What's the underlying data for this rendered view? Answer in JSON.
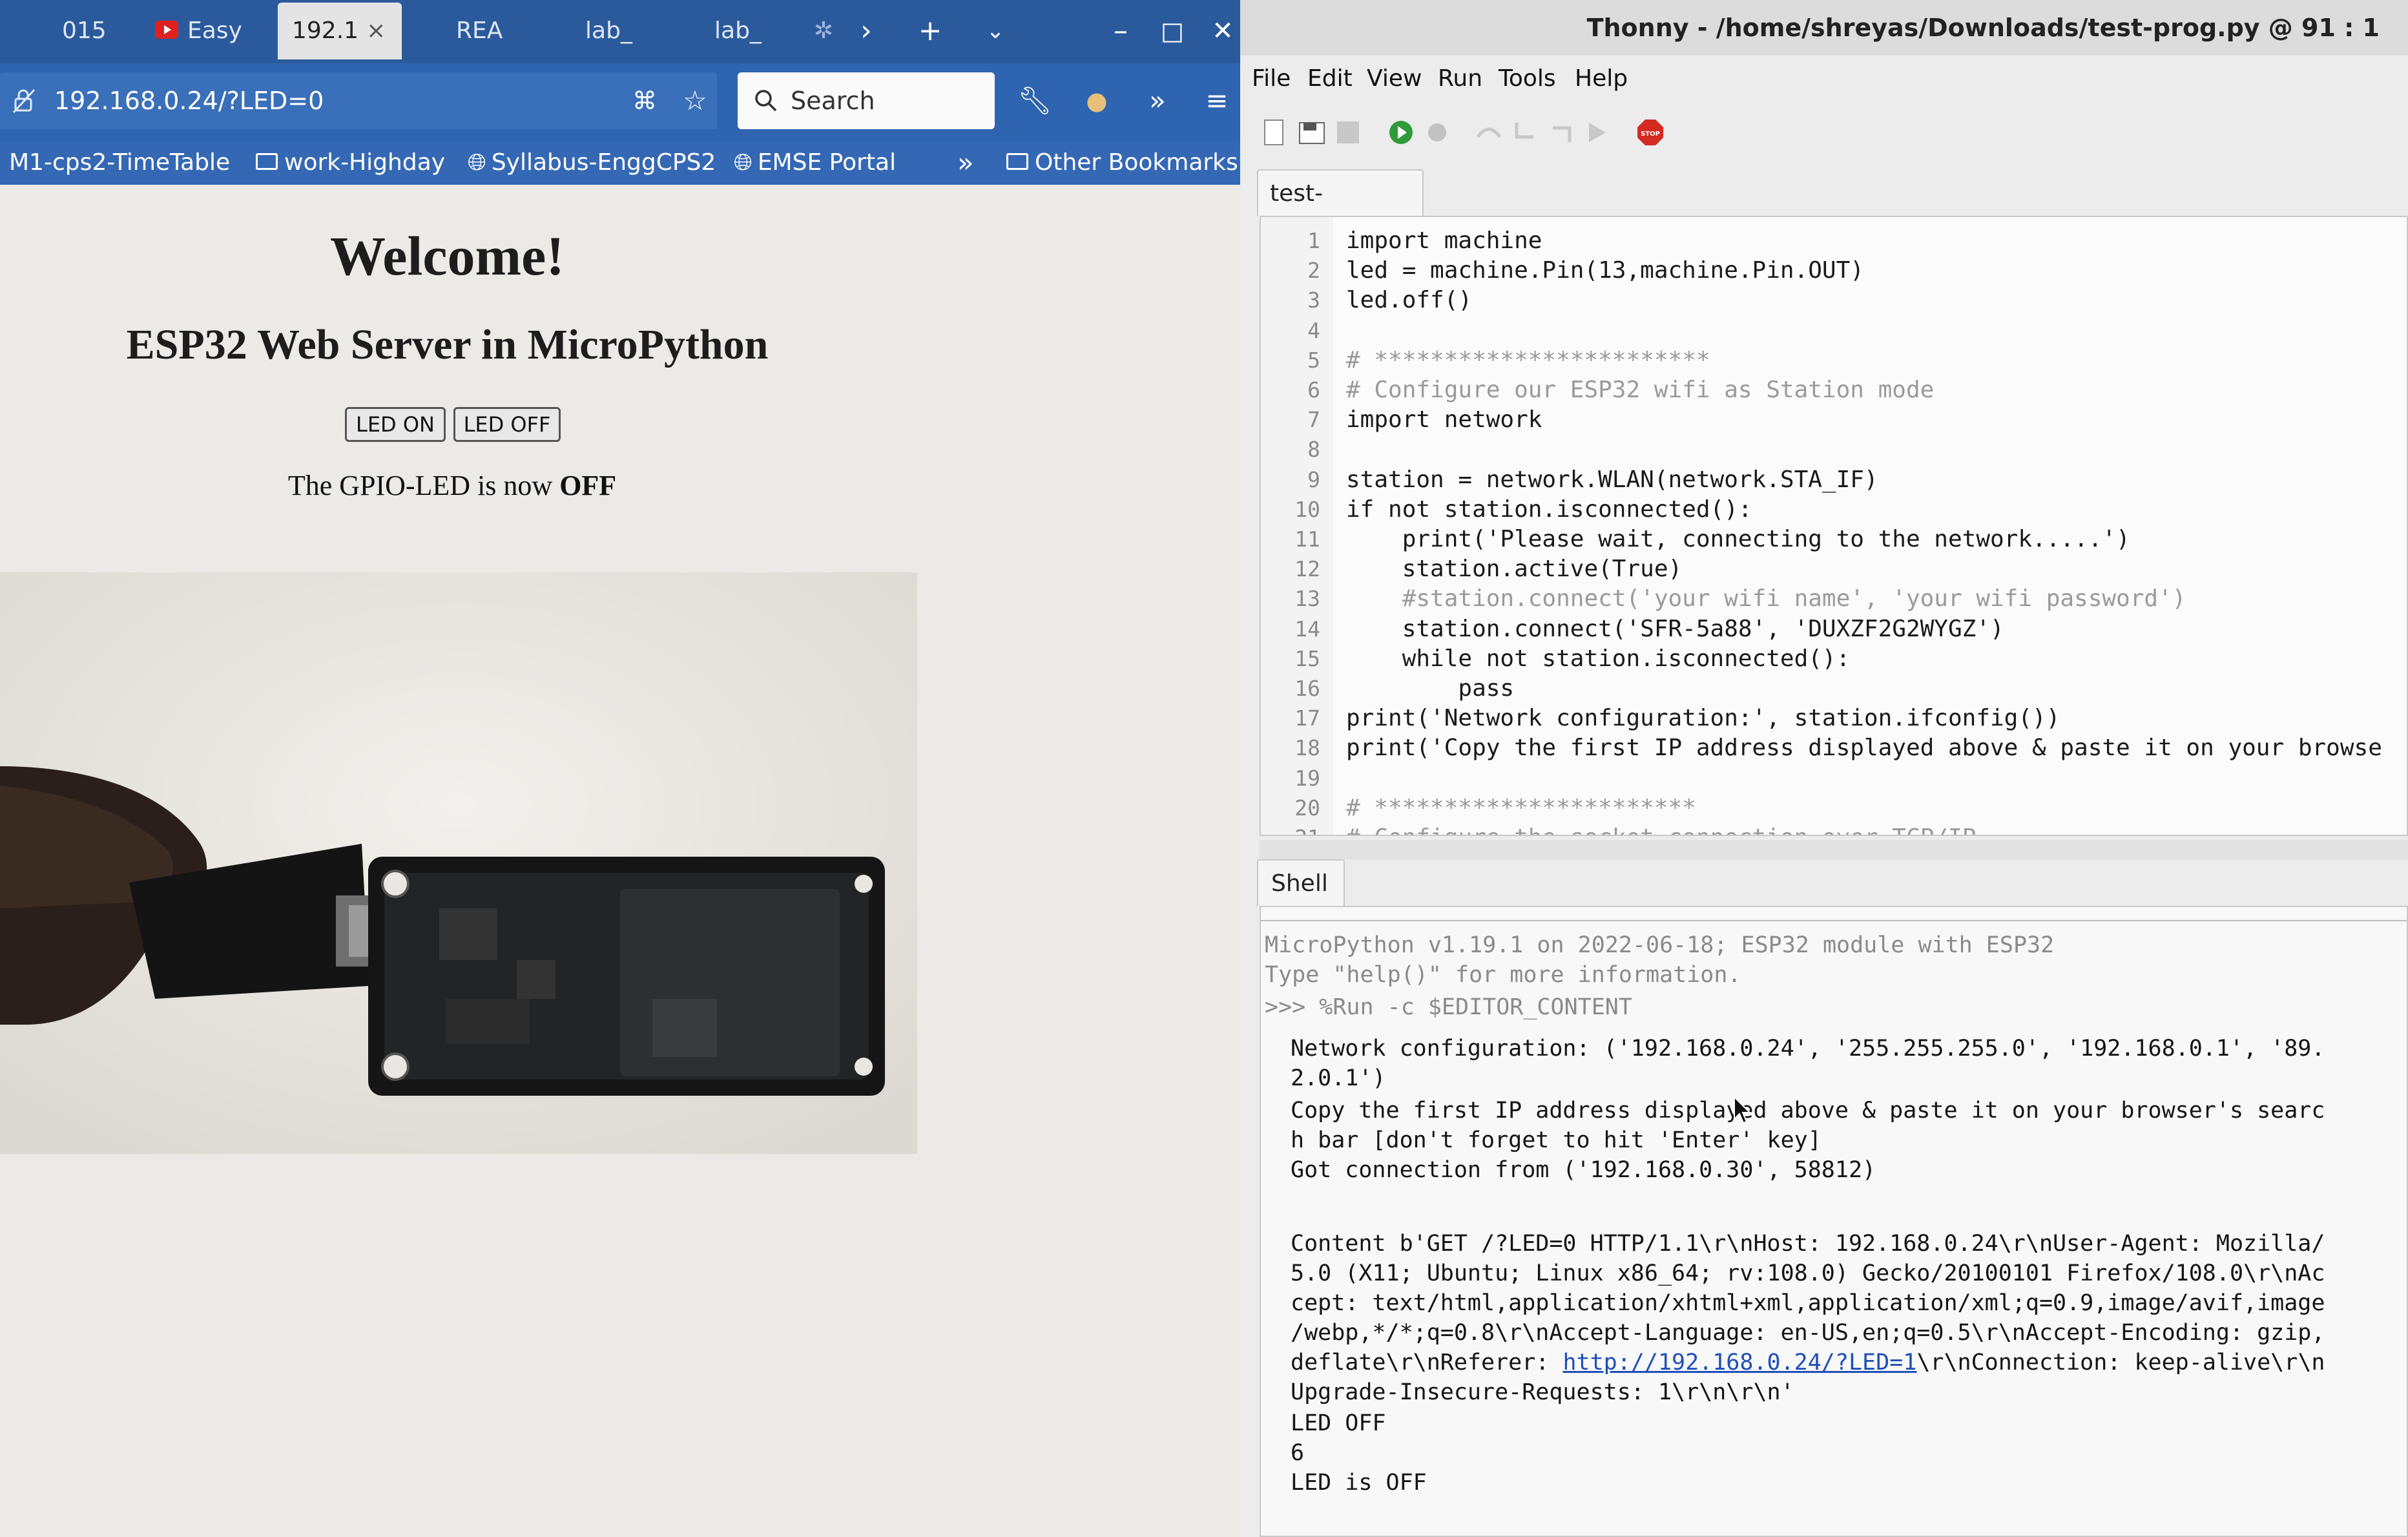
{
  "firefox": {
    "tabs": [
      {
        "label": "015",
        "active": false
      },
      {
        "label": "Easy",
        "active": false
      },
      {
        "label": "192.1",
        "active": true
      },
      {
        "label": "REA",
        "active": false
      },
      {
        "label": "lab_",
        "active": false
      },
      {
        "label": "lab_",
        "active": false
      }
    ],
    "tab_close": "×",
    "url": "192.168.0.24/?LED=0",
    "search_placeholder": "Search",
    "bookmarks": [
      {
        "label": "M1-cps2-TimeTable",
        "icon": "none"
      },
      {
        "label": "work-Highday",
        "icon": "folder-icon"
      },
      {
        "label": "Syllabus-EnggCPS2",
        "icon": "globe-icon"
      },
      {
        "label": "EMSE Portal",
        "icon": "globe-icon"
      },
      {
        "label": "Other Bookmarks",
        "icon": "folder-icon"
      }
    ],
    "page": {
      "heading": "Welcome!",
      "subheading": "ESP32 Web Server in MicroPython",
      "btn_on": "LED ON",
      "btn_off": "LED OFF",
      "status_prefix": "The GPIO-LED is now",
      "status_value": "OFF"
    },
    "colors": {
      "tabbar": "#2b5a9c",
      "navbar": "#2f64b0",
      "bookmarks": "#3568b4",
      "page_bg": "#eceae6"
    }
  },
  "thonny": {
    "title": "Thonny  -  /home/shreyas/Downloads/test-prog.py  @  91 : 1",
    "menus": [
      "File",
      "Edit",
      "View",
      "Run",
      "Tools",
      "Help"
    ],
    "editor_tab": "test-prog.py",
    "code": [
      {
        "n": "1",
        "text": "import machine",
        "cls": "kw"
      },
      {
        "n": "2",
        "text": "led = machine.Pin(13,machine.Pin.OUT)",
        "cls": ""
      },
      {
        "n": "3",
        "text": "led.off()",
        "cls": ""
      },
      {
        "n": "4",
        "text": "",
        "cls": ""
      },
      {
        "n": "5",
        "text": "# ************************",
        "cls": "comment"
      },
      {
        "n": "6",
        "text": "# Configure our ESP32 wifi as Station mode",
        "cls": "comment"
      },
      {
        "n": "7",
        "text": "import network",
        "cls": "kw"
      },
      {
        "n": "8",
        "text": "",
        "cls": ""
      },
      {
        "n": "9",
        "text": "station = network.WLAN(network.STA_IF)",
        "cls": ""
      },
      {
        "n": "10",
        "text": "if not station.isconnected():",
        "cls": "kw"
      },
      {
        "n": "11",
        "text": "    print('Please wait, connecting to the network.....')",
        "cls": ""
      },
      {
        "n": "12",
        "text": "    station.active(True)",
        "cls": ""
      },
      {
        "n": "13",
        "text": "    #station.connect('your wifi name', 'your wifi password')",
        "cls": "comment"
      },
      {
        "n": "14",
        "text": "    station.connect('SFR-5a88', 'DUXZF2G2WYGZ')",
        "cls": ""
      },
      {
        "n": "15",
        "text": "    while not station.isconnected():",
        "cls": "kw"
      },
      {
        "n": "16",
        "text": "        pass",
        "cls": "kw"
      },
      {
        "n": "17",
        "text": "print('Network configuration:', station.ifconfig())",
        "cls": ""
      },
      {
        "n": "18",
        "text": "print('Copy the first IP address displayed above & paste it on your browse",
        "cls": ""
      },
      {
        "n": "19",
        "text": "",
        "cls": ""
      },
      {
        "n": "20",
        "text": "# ***********************",
        "cls": "comment"
      },
      {
        "n": "21",
        "text": "# Configure the socket connection over TCP/IP",
        "cls": "comment"
      }
    ],
    "shell_tab": "Shell",
    "shell": [
      {
        "text": "MicroPython v1.19.1 on 2022-06-18; ESP32 module with ESP32",
        "cls": "dim"
      },
      {
        "text": "Type \"help()\" for more information.",
        "cls": "dim"
      },
      {
        "text": ">>> %Run -c $EDITOR_CONTENT",
        "cls": "dim"
      },
      {
        "text": "Network configuration: ('192.168.0.24', '255.255.255.0', '192.168.0.1', '89.",
        "cls": ""
      },
      {
        "text": "2.0.1')",
        "cls": ""
      },
      {
        "text": "Copy the first IP address displayed above & paste it on your browser's searc",
        "cls": ""
      },
      {
        "text": "h bar [don't forget to hit 'Enter' key]",
        "cls": ""
      },
      {
        "text": "Got connection from ('192.168.0.30', 58812)",
        "cls": ""
      },
      {
        "text": "Content b'GET /?LED=0 HTTP/1.1\\r\\nHost: 192.168.0.24\\r\\nUser-Agent: Mozilla/",
        "cls": ""
      },
      {
        "text": "5.0 (X11; Ubuntu; Linux x86_64; rv:108.0) Gecko/20100101 Firefox/108.0\\r\\nAc",
        "cls": ""
      },
      {
        "text": "cept: text/html,application/xhtml+xml,application/xml;q=0.9,image/avif,image",
        "cls": ""
      },
      {
        "text": "/webp,*/*;q=0.8\\r\\nAccept-Language: en-US,en;q=0.5\\r\\nAccept-Encoding: gzip,",
        "cls": ""
      },
      {
        "text": "Upgrade-Insecure-Requests: 1\\r\\n\\r\\n'",
        "cls": ""
      },
      {
        "text": "LED OFF",
        "cls": ""
      },
      {
        "text": "6",
        "cls": ""
      },
      {
        "text": "LED is OFF",
        "cls": ""
      }
    ],
    "referer_line": {
      "before": "deflate\\r\\nReferer: ",
      "link": "http://192.168.0.24/?LED=1",
      "after": "\\r\\nConnection: keep-alive\\r\\n"
    }
  }
}
